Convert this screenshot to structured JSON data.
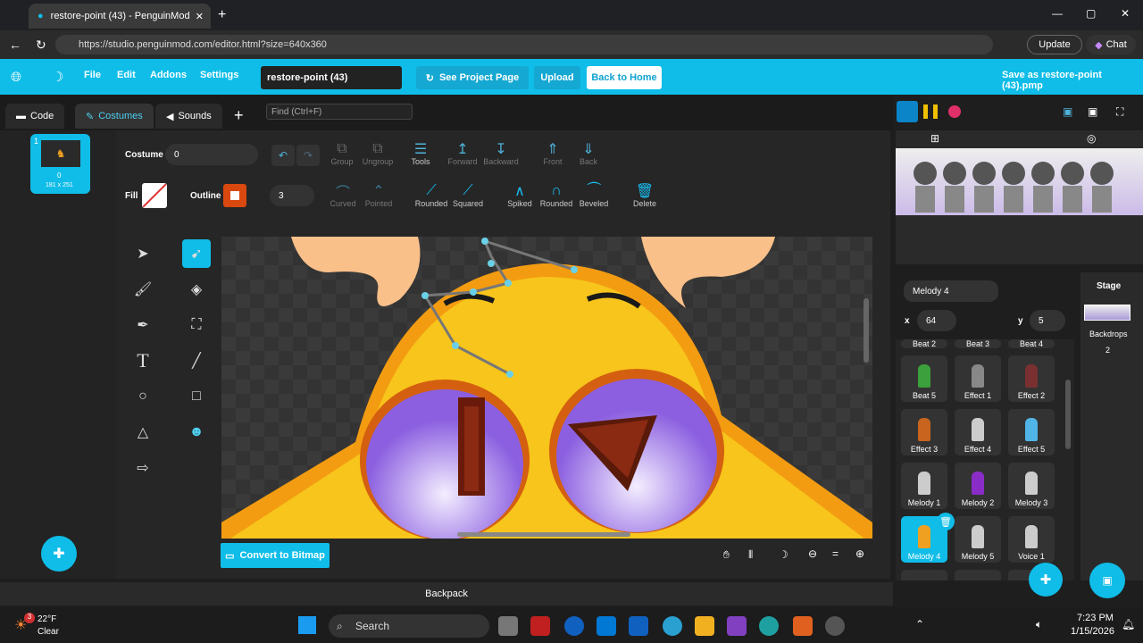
{
  "browser": {
    "tab_title": "restore-point (43) - PenguinMod",
    "url": "https://studio.penguinmod.com/editor.html?size=640x360",
    "update_label": "Update",
    "chat_label": "Chat"
  },
  "menu": {
    "file": "File",
    "edit": "Edit",
    "addons": "Addons",
    "settings": "Settings",
    "project_title": "restore-point (43)",
    "see_project": "See Project Page",
    "upload": "Upload",
    "back_home": "Back to Home",
    "save_as": "Save as restore-point (43).pmp"
  },
  "tabs": {
    "code": "Code",
    "costumes": "Costumes",
    "sounds": "Sounds",
    "find_placeholder": "Find (Ctrl+F)"
  },
  "costume_list": {
    "index": "1",
    "name": "0",
    "size": "181 x 251"
  },
  "editor": {
    "costume_label": "Costume",
    "costume_value": "0",
    "fill_label": "Fill",
    "outline_label": "Outline",
    "outline_width": "3",
    "group": "Group",
    "ungroup": "Ungroup",
    "tools": "Tools",
    "forward": "Forward",
    "backward": "Backward",
    "front": "Front",
    "back": "Back",
    "curved": "Curved",
    "pointed": "Pointed",
    "rounded1": "Rounded",
    "squared": "Squared",
    "spiked": "Spiked",
    "rounded2": "Rounded",
    "beveled": "Beveled",
    "delete": "Delete",
    "convert": "Convert to Bitmap"
  },
  "sprite": {
    "name": "Melody 4",
    "x_label": "x",
    "x": "64",
    "y_label": "y",
    "y": "5"
  },
  "stage": {
    "label": "Stage",
    "backdrops_label": "Backdrops",
    "backdrops_count": "2"
  },
  "sprites": [
    {
      "name": "Beat 5",
      "color": "#3ca03c"
    },
    {
      "name": "Effect 1",
      "color": "#888"
    },
    {
      "name": "Effect 2",
      "color": "#7a3030"
    },
    {
      "name": "Effect 3",
      "color": "#c8641e"
    },
    {
      "name": "Effect 4",
      "color": "#ccc"
    },
    {
      "name": "Effect 5",
      "color": "#50b4e6"
    },
    {
      "name": "Melody 1",
      "color": "#ccc"
    },
    {
      "name": "Melody 2",
      "color": "#8a2cc8"
    },
    {
      "name": "Melody 3",
      "color": "#ccc"
    },
    {
      "name": "Melody 4",
      "color": "#f0a020"
    },
    {
      "name": "Melody 5",
      "color": "#ccc"
    },
    {
      "name": "Voice 1",
      "color": "#ccc"
    }
  ],
  "sprites_partial_top": [
    "Beat 2",
    "Beat 3",
    "Beat 4"
  ],
  "backpack": "Backpack",
  "taskbar": {
    "temp": "22°F",
    "weather": "Clear",
    "search": "Search",
    "time": "7:23 PM",
    "date": "1/15/2026",
    "badge": "3"
  }
}
